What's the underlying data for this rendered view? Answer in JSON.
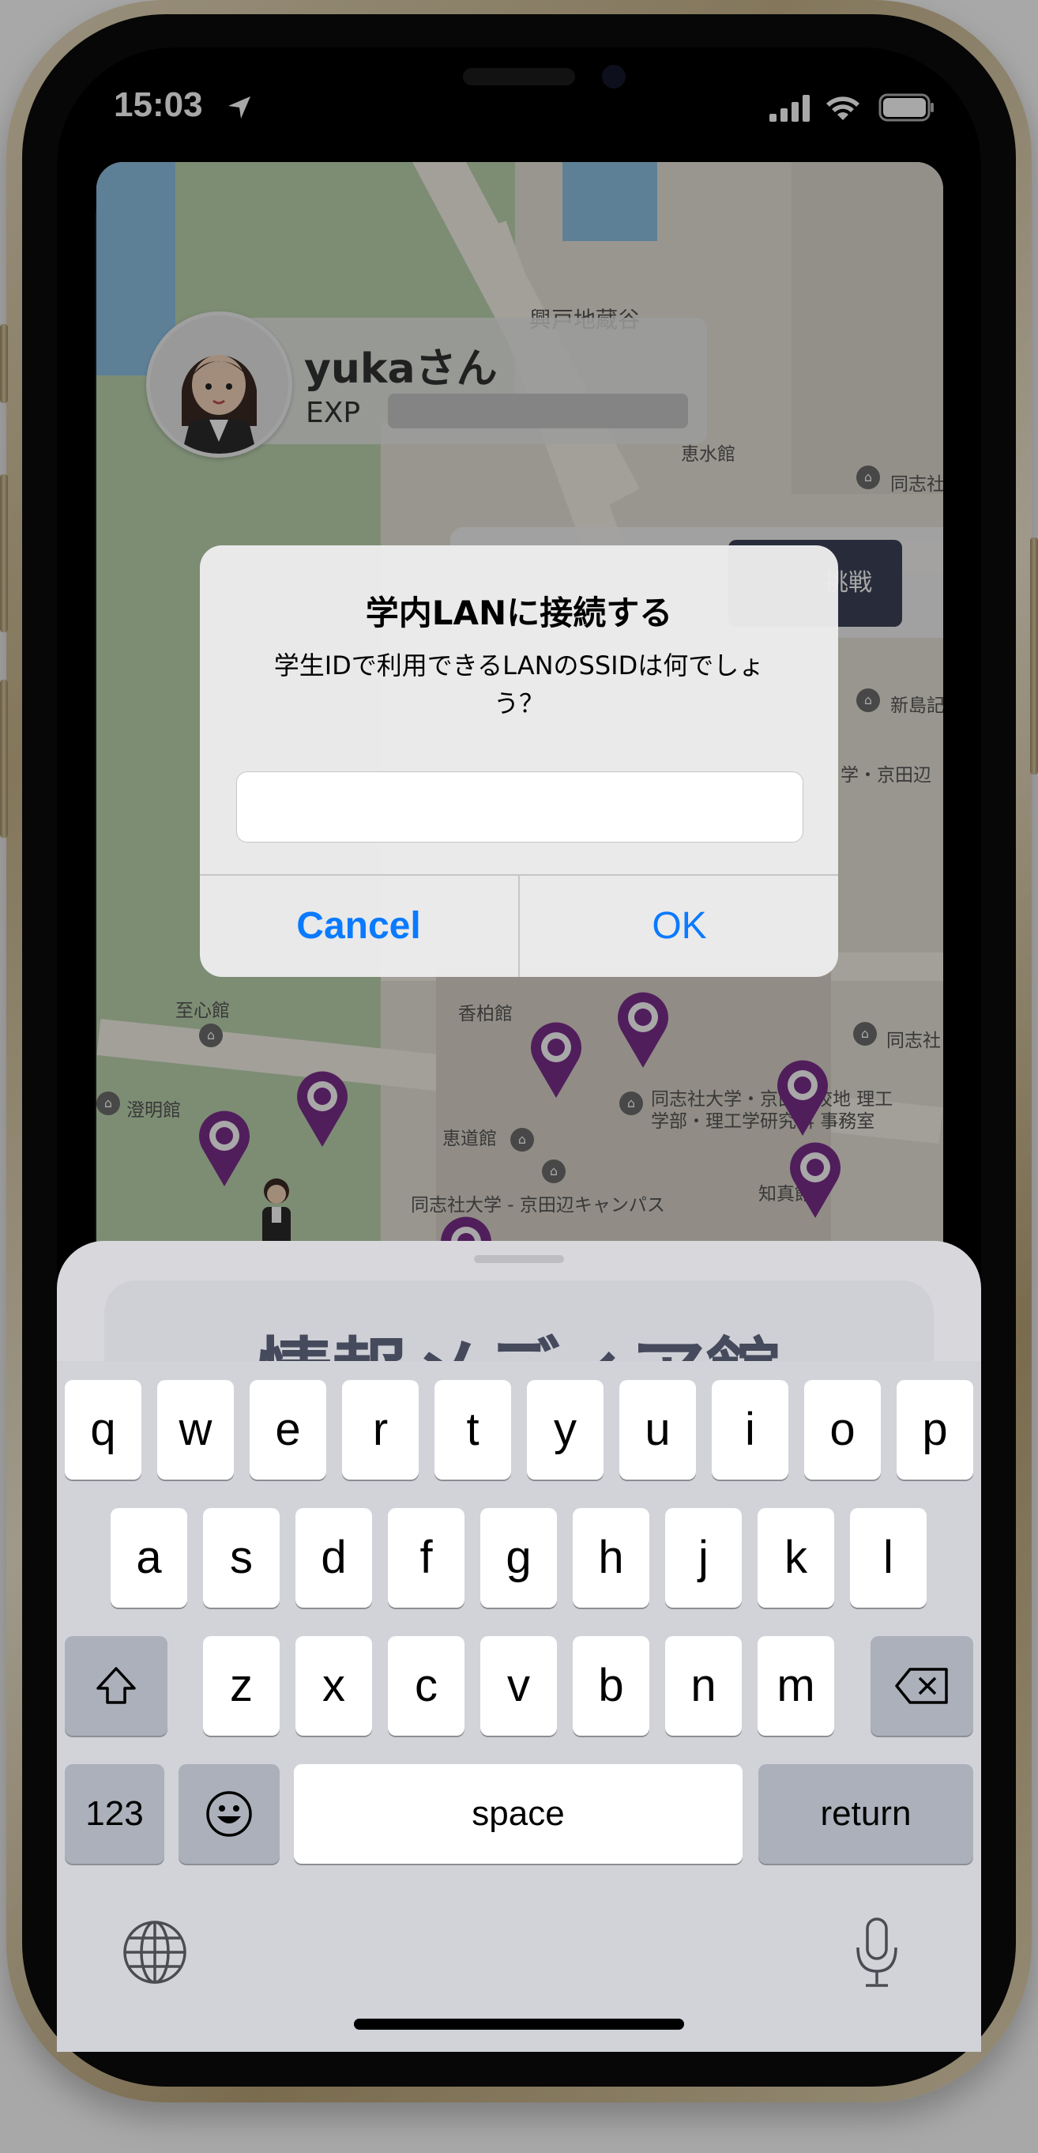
{
  "status": {
    "time": "15:03"
  },
  "map": {
    "labels": [
      "興戸地蔵谷",
      "恵水館",
      "同志社",
      "新島記",
      "学・京田辺",
      "至心館",
      "香柏館",
      "同志社",
      "澄明館",
      "同志社大学・京田辺校地 理工",
      "学部・理工学研究科 事務室",
      "恵道館",
      "知真館",
      "同志社大学 - 京田辺キャンパス"
    ],
    "challenge_label": "挑戦"
  },
  "profile": {
    "name": "yukaさん",
    "exp_label": "EXP",
    "exp_progress": 0
  },
  "sheet": {
    "title": "情報メディア館"
  },
  "alert": {
    "title": "学内LANに接続する",
    "message": "学生IDで利用できるLANのSSIDは何でしょう？",
    "input_value": "",
    "cancel_label": "Cancel",
    "ok_label": "OK"
  },
  "keyboard": {
    "row1": [
      "q",
      "w",
      "e",
      "r",
      "t",
      "y",
      "u",
      "i",
      "o",
      "p"
    ],
    "row2": [
      "a",
      "s",
      "d",
      "f",
      "g",
      "h",
      "j",
      "k",
      "l"
    ],
    "row3": [
      "z",
      "x",
      "c",
      "v",
      "b",
      "n",
      "m"
    ],
    "numbers_label": "123",
    "space_label": "space",
    "return_label": "return"
  },
  "icons": [
    "location-arrow-icon",
    "signal-icon",
    "wifi-icon",
    "battery-icon",
    "shift-icon",
    "backspace-icon",
    "emoji-icon",
    "globe-icon",
    "mic-icon",
    "pin-icon",
    "school-icon"
  ]
}
